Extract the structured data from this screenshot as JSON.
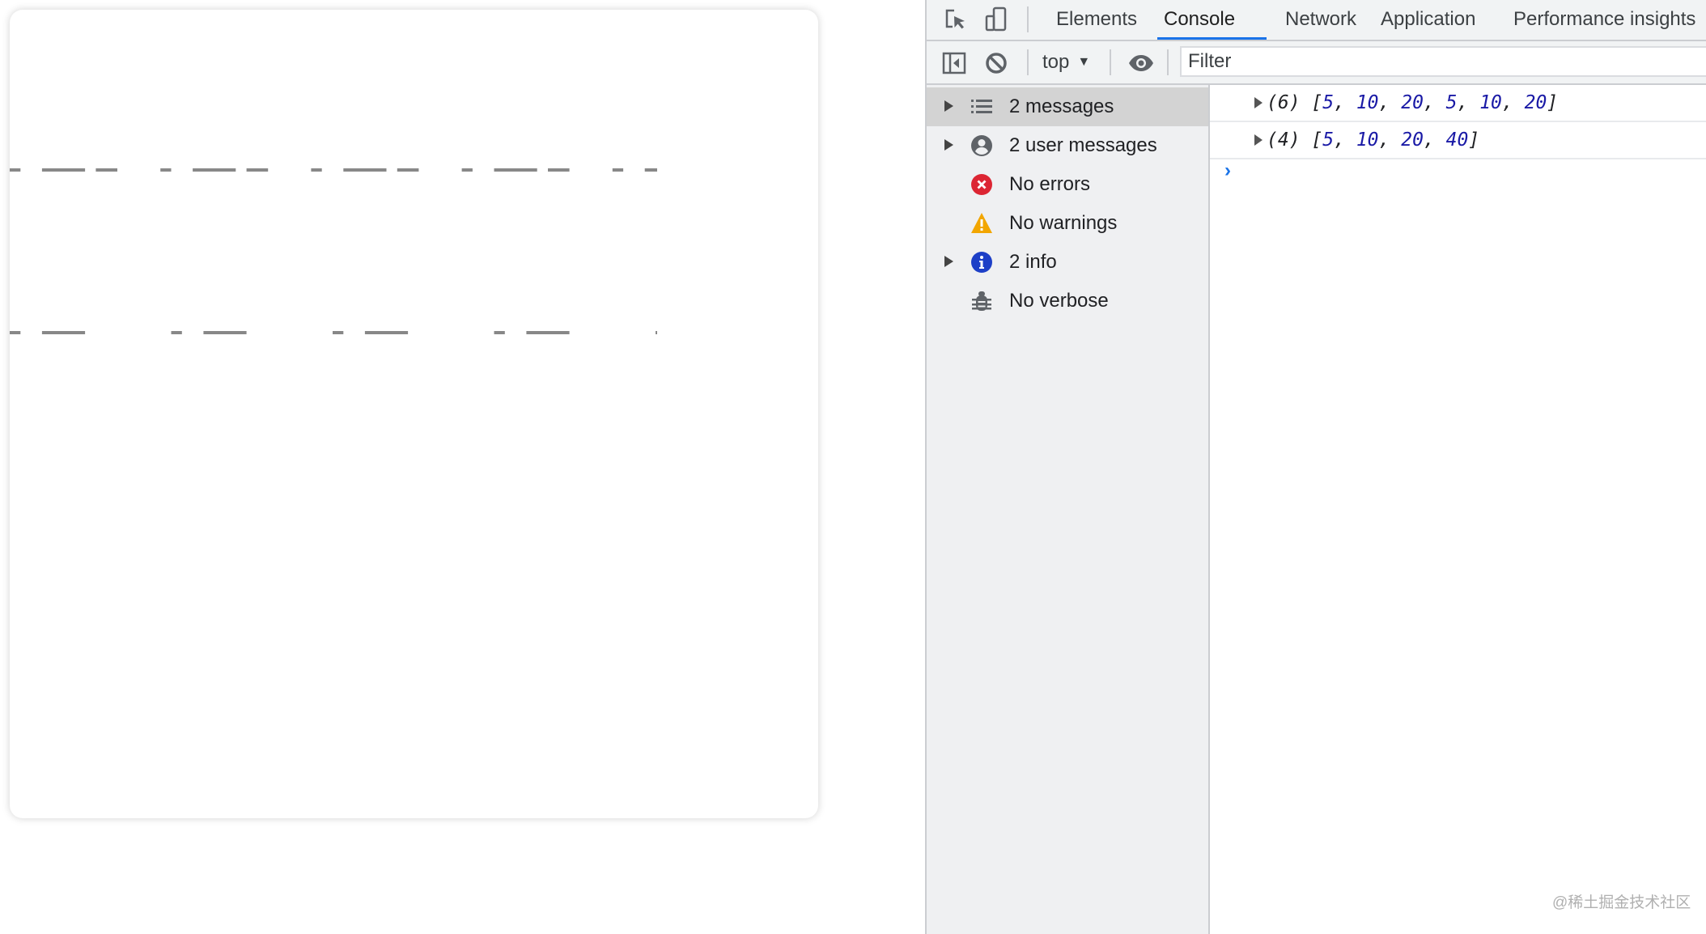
{
  "canvas": {
    "line_color": "#888888",
    "lines": [
      {
        "name": "dashed-line-top",
        "dash_pattern": [
          5,
          10,
          20,
          5,
          10,
          20
        ]
      },
      {
        "name": "dashed-line-bottom",
        "dash_pattern": [
          5,
          10,
          20,
          40
        ]
      }
    ]
  },
  "devtools": {
    "tabs": [
      {
        "label": "Elements",
        "active": false
      },
      {
        "label": "Console",
        "active": true
      },
      {
        "label": "Network",
        "active": false
      },
      {
        "label": "Application",
        "active": false
      },
      {
        "label": "Performance insights",
        "active": false
      }
    ],
    "toolbar": {
      "context": "top",
      "filter_placeholder": "Filter"
    },
    "sidebar": {
      "items": [
        {
          "label": "2 messages",
          "icon": "list-icon",
          "expandable": true,
          "selected": true
        },
        {
          "label": "2 user messages",
          "icon": "user-icon",
          "expandable": true,
          "selected": false
        },
        {
          "label": "No errors",
          "icon": "error-icon",
          "expandable": false,
          "selected": false
        },
        {
          "label": "No warnings",
          "icon": "warning-icon",
          "expandable": false,
          "selected": false
        },
        {
          "label": "2 info",
          "icon": "info-icon",
          "expandable": true,
          "selected": false
        },
        {
          "label": "No verbose",
          "icon": "bug-icon",
          "expandable": false,
          "selected": false
        }
      ]
    },
    "console": {
      "messages": [
        {
          "count": "(6)",
          "values": [
            5,
            10,
            20,
            5,
            10,
            20
          ]
        },
        {
          "count": "(4)",
          "values": [
            5,
            10,
            20,
            40
          ]
        }
      ],
      "prompt": "›"
    },
    "colors": {
      "accent": "#1a73e8",
      "error": "#dc2533",
      "warning": "#f2a600",
      "info": "#1d3fc7",
      "number": "#1a1aa6"
    }
  },
  "watermark": "@稀土掘金技术社区"
}
